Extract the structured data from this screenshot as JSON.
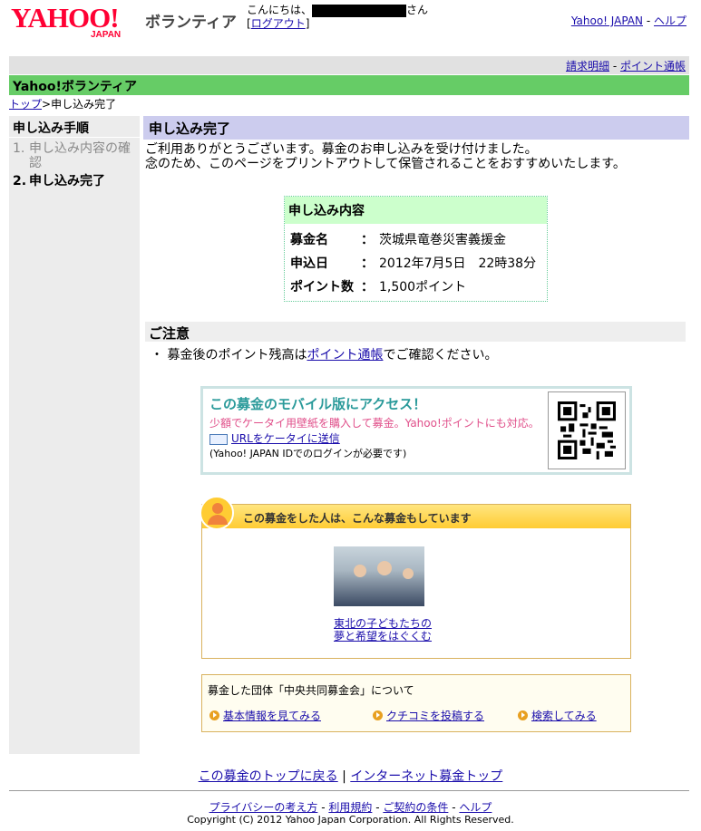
{
  "header": {
    "logo_text": "YAHOO!",
    "logo_sub": "JAPAN",
    "service_name": "ボランティア",
    "greeting_prefix": "こんにちは、",
    "greeting_suffix": "さん",
    "logout_open": "[",
    "logout_label": "ログアウト",
    "logout_close": "]",
    "yahoo_japan_link": "Yahoo! JAPAN",
    "separator": "-",
    "help_link": "ヘルプ"
  },
  "subnav": {
    "billing_link": "請求明細",
    "separator": "-",
    "points_link": "ポイント通帳"
  },
  "section_bar": "Yahoo!ボランティア",
  "breadcrumb": {
    "top_link": "トップ",
    "separator": ">",
    "current": "申し込み完了"
  },
  "sidebar": {
    "title": "申し込み手順",
    "steps": [
      {
        "num": "1.",
        "label": "申し込み内容の確認"
      },
      {
        "num": "2.",
        "label": "申し込み完了"
      }
    ]
  },
  "main": {
    "title": "申し込み完了",
    "thanks_line1": "ご利用ありがとうございます。募金のお申し込みを受け付けました。",
    "thanks_line2": "念のため、このページをプリントアウトして保管されることをおすすめいたします。"
  },
  "details": {
    "heading": "申し込み内容",
    "colon": "：",
    "rows": [
      {
        "key": "募金名",
        "value": "茨城県竜巻災害義援金"
      },
      {
        "key": "申込日",
        "value": "2012年7月5日　22時38分"
      },
      {
        "key": "ポイント数",
        "value": "1,500ポイント"
      }
    ]
  },
  "notice": {
    "title": "ご注意",
    "bullet": "・",
    "text_before": "募金後のポイント残高は",
    "link": "ポイント通帳",
    "text_after": "でご確認ください。"
  },
  "mobile": {
    "title": "この募金のモバイル版にアクセス！",
    "desc": "少額でケータイ用壁紙を購入して募金。Yahoo!ポイントにも対応。",
    "send_link": "URLをケータイに送信",
    "note": "(Yahoo! JAPAN IDでのログインが必要です)"
  },
  "related": {
    "heading": "この募金をした人は、こんな募金もしています",
    "caption_line1": "東北の子どもたちの",
    "caption_line2": "夢と希望をはぐくむ"
  },
  "org": {
    "line": "募金した団体「中央共同募金会」について",
    "links": [
      "基本情報を見てみる",
      "クチコミを投稿する",
      "検索してみる"
    ]
  },
  "bottom_nav": {
    "back_link": "この募金のトップに戻る",
    "separator": "|",
    "top_link": "インターネット募金トップ"
  },
  "footer": {
    "links": [
      "プライバシーの考え方",
      "利用規約",
      "ご契約の条件",
      "ヘルプ"
    ],
    "separator": "-",
    "copyright": "Copyright (C) 2012 Yahoo Japan Corporation. All Rights Reserved."
  },
  "colors": {
    "green_bar": "#66cc66",
    "title_bar": "#ccccee",
    "link": "#1a0dab",
    "logo_red": "#ff0033"
  }
}
